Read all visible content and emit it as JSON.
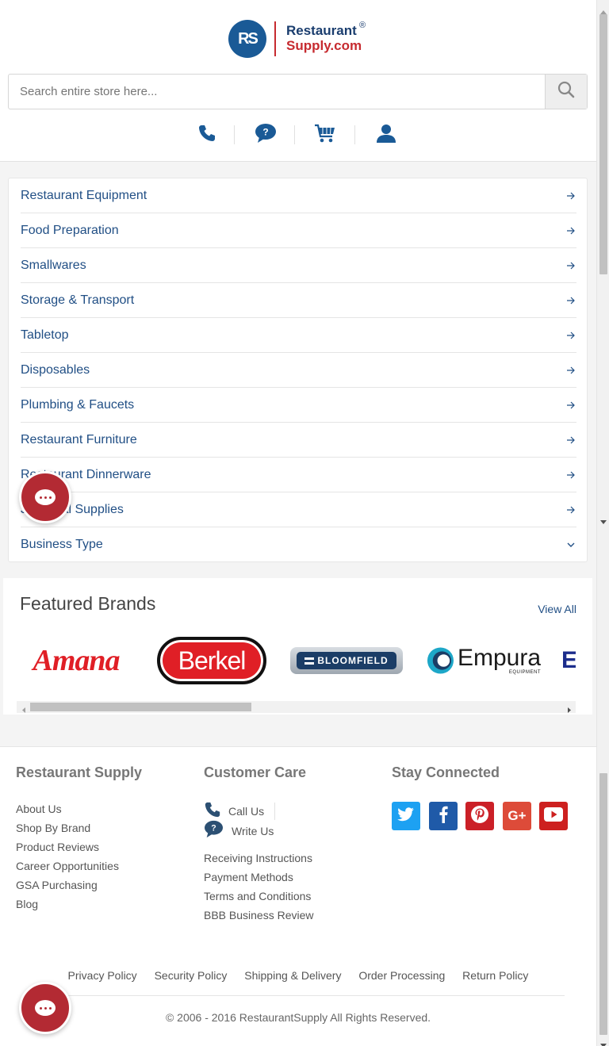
{
  "header": {
    "logo": {
      "initials": "RS",
      "line1": "Restaurant",
      "line2": "Supply.com",
      "reg": "®",
      "colors": {
        "blue": "#1a5a96",
        "red": "#c62a2f"
      }
    },
    "search": {
      "placeholder": "Search entire store here...",
      "button_icon": "search-icon"
    },
    "icons": [
      "phone-icon",
      "help-chat-icon",
      "cart-icon",
      "account-icon"
    ]
  },
  "menu": {
    "items": [
      {
        "label": "Restaurant Equipment",
        "icon": "arrow-right-icon"
      },
      {
        "label": "Food Preparation",
        "icon": "arrow-right-icon"
      },
      {
        "label": "Smallwares",
        "icon": "arrow-right-icon"
      },
      {
        "label": "Storage & Transport",
        "icon": "arrow-right-icon"
      },
      {
        "label": "Tabletop",
        "icon": "arrow-right-icon"
      },
      {
        "label": "Disposables",
        "icon": "arrow-right-icon"
      },
      {
        "label": "Plumbing & Faucets",
        "icon": "arrow-right-icon"
      },
      {
        "label": "Restaurant Furniture",
        "icon": "arrow-right-icon"
      },
      {
        "label": "Restaurant Dinnerware",
        "icon": "arrow-right-icon"
      },
      {
        "label": "Janitorial Supplies",
        "icon": "arrow-right-icon"
      },
      {
        "label": "Business Type",
        "icon": "chevron-down-icon"
      }
    ]
  },
  "brands": {
    "title": "Featured Brands",
    "view_all": "View All",
    "items": [
      {
        "name": "Amana"
      },
      {
        "name": "Berkel"
      },
      {
        "name": "BLOOMFIELD"
      },
      {
        "name": "Empura",
        "sub": "EQUIPMENT"
      },
      {
        "name": "E"
      }
    ]
  },
  "footer": {
    "col1": {
      "heading": "Restaurant Supply",
      "links": [
        "About Us",
        "Shop By Brand",
        "Product Reviews",
        "Career Opportunities",
        "GSA Purchasing",
        "Blog"
      ]
    },
    "col2": {
      "heading": "Customer Care",
      "call": "Call Us",
      "write": "Write Us",
      "links": [
        "Receiving Instructions",
        "Payment Methods",
        "Terms and Conditions",
        "BBB Business Review"
      ]
    },
    "col3": {
      "heading": "Stay Connected",
      "social": [
        {
          "icon": "twitter-icon",
          "color": "#1da1f2"
        },
        {
          "icon": "facebook-icon",
          "color": "#1f5aa8"
        },
        {
          "icon": "pinterest-icon",
          "color": "#cb2027"
        },
        {
          "icon": "google-plus-icon",
          "color": "#dd4b39"
        },
        {
          "icon": "youtube-icon",
          "color": "#cd201f"
        }
      ]
    },
    "bottom_links": [
      "Privacy Policy",
      "Security Policy",
      "Shipping & Delivery",
      "Order Processing",
      "Return Policy"
    ],
    "copyright": "© 2006 - 2016 RestaurantSupply All Rights Reserved."
  },
  "colors": {
    "link": "#214f85",
    "chat": "#b32a33"
  }
}
